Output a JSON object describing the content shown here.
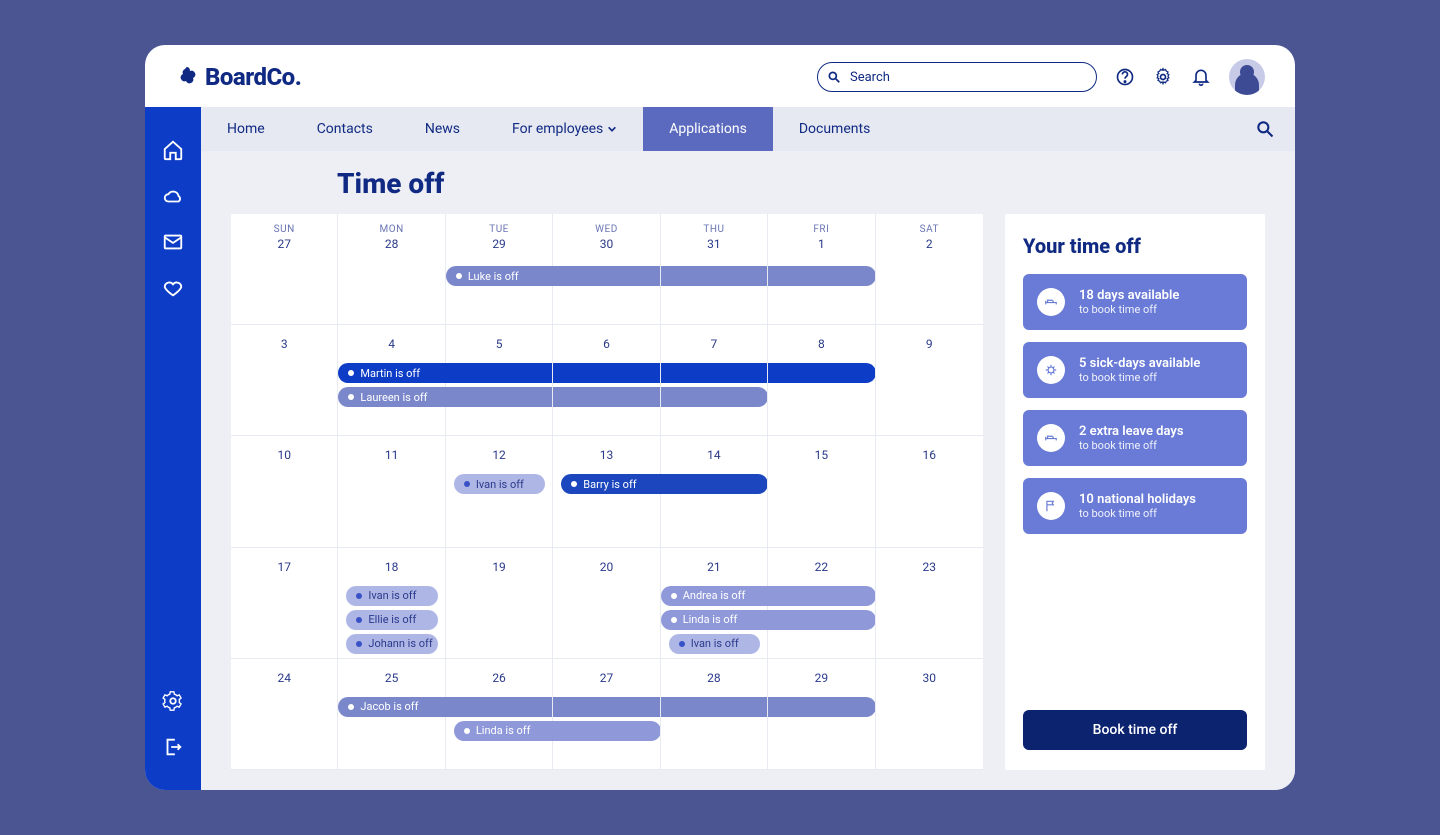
{
  "brand": {
    "name": "BoardCo."
  },
  "search": {
    "placeholder": "Search"
  },
  "nav": {
    "items": [
      {
        "label": "Home"
      },
      {
        "label": "Contacts"
      },
      {
        "label": "News"
      },
      {
        "label": "For employees",
        "dropdown": true
      },
      {
        "label": "Applications",
        "active": true
      },
      {
        "label": "Documents"
      }
    ]
  },
  "page": {
    "title": "Time off"
  },
  "calendar": {
    "day_labels": [
      "SUN",
      "MON",
      "TUE",
      "WED",
      "THU",
      "FRI",
      "SAT"
    ],
    "weeks": [
      [
        {
          "n": "27"
        },
        {
          "n": "28"
        },
        {
          "n": "29"
        },
        {
          "n": "30"
        },
        {
          "n": "31"
        },
        {
          "n": "1"
        },
        {
          "n": "2"
        }
      ],
      [
        {
          "n": "3"
        },
        {
          "n": "4"
        },
        {
          "n": "5"
        },
        {
          "n": "6"
        },
        {
          "n": "7"
        },
        {
          "n": "8"
        },
        {
          "n": "9"
        }
      ],
      [
        {
          "n": "10"
        },
        {
          "n": "11"
        },
        {
          "n": "12"
        },
        {
          "n": "13"
        },
        {
          "n": "14"
        },
        {
          "n": "15"
        },
        {
          "n": "16"
        }
      ],
      [
        {
          "n": "17"
        },
        {
          "n": "18"
        },
        {
          "n": "19"
        },
        {
          "n": "20"
        },
        {
          "n": "21"
        },
        {
          "n": "22"
        },
        {
          "n": "23"
        }
      ],
      [
        {
          "n": "24"
        },
        {
          "n": "25"
        },
        {
          "n": "26"
        },
        {
          "n": "27"
        },
        {
          "n": "28"
        },
        {
          "n": "29"
        },
        {
          "n": "30"
        }
      ]
    ],
    "events": [
      {
        "row": 0,
        "start": 2,
        "span": 4,
        "label": "Luke is off",
        "color": "mid",
        "slot": 0
      },
      {
        "row": 1,
        "start": 1,
        "span": 5,
        "label": "Martin is off",
        "color": "dark",
        "slot": 0
      },
      {
        "row": 1,
        "start": 1,
        "span": 4,
        "label": "Laureen is off",
        "color": "mid",
        "slot": 1
      },
      {
        "row": 2,
        "start": 2,
        "span": 1,
        "label": "Ivan is off",
        "color": "light2",
        "slot": 0,
        "inset": true
      },
      {
        "row": 2,
        "start": 3,
        "span": 2,
        "label": "Barry is off",
        "color": "darkblue",
        "slot": 0,
        "inset_left": true
      },
      {
        "row": 3,
        "start": 1,
        "span": 1,
        "label": "Ivan is off",
        "color": "light2",
        "slot": 0,
        "inset": true
      },
      {
        "row": 3,
        "start": 1,
        "span": 1,
        "label": "Ellie is off",
        "color": "light2",
        "slot": 1,
        "inset": true
      },
      {
        "row": 3,
        "start": 1,
        "span": 1,
        "label": "Johann is off",
        "color": "light2",
        "slot": 2,
        "inset": true
      },
      {
        "row": 3,
        "start": 4,
        "span": 2,
        "label": "Andrea is off",
        "color": "light",
        "slot": 0
      },
      {
        "row": 3,
        "start": 4,
        "span": 2,
        "label": "Linda is off",
        "color": "light",
        "slot": 1
      },
      {
        "row": 3,
        "start": 4,
        "span": 1,
        "label": "Ivan is off",
        "color": "light2",
        "slot": 2,
        "inset": true
      },
      {
        "row": 4,
        "start": 1,
        "span": 5,
        "label": "Jacob is off",
        "color": "mid",
        "slot": 0
      },
      {
        "row": 4,
        "start": 2,
        "span": 2,
        "label": "Linda is off",
        "color": "light",
        "slot": 1,
        "inset_left": true
      }
    ]
  },
  "side": {
    "title": "Your time off",
    "cards": [
      {
        "title": "18 days available",
        "sub": "to book time off",
        "icon": "bed"
      },
      {
        "title": "5 sick-days available",
        "sub": "to book time off",
        "icon": "virus"
      },
      {
        "title": "2 extra leave days",
        "sub": "to book time off",
        "icon": "bed"
      },
      {
        "title": "10 national holidays",
        "sub": "to book time off",
        "icon": "flag"
      }
    ],
    "button": "Book time off"
  }
}
